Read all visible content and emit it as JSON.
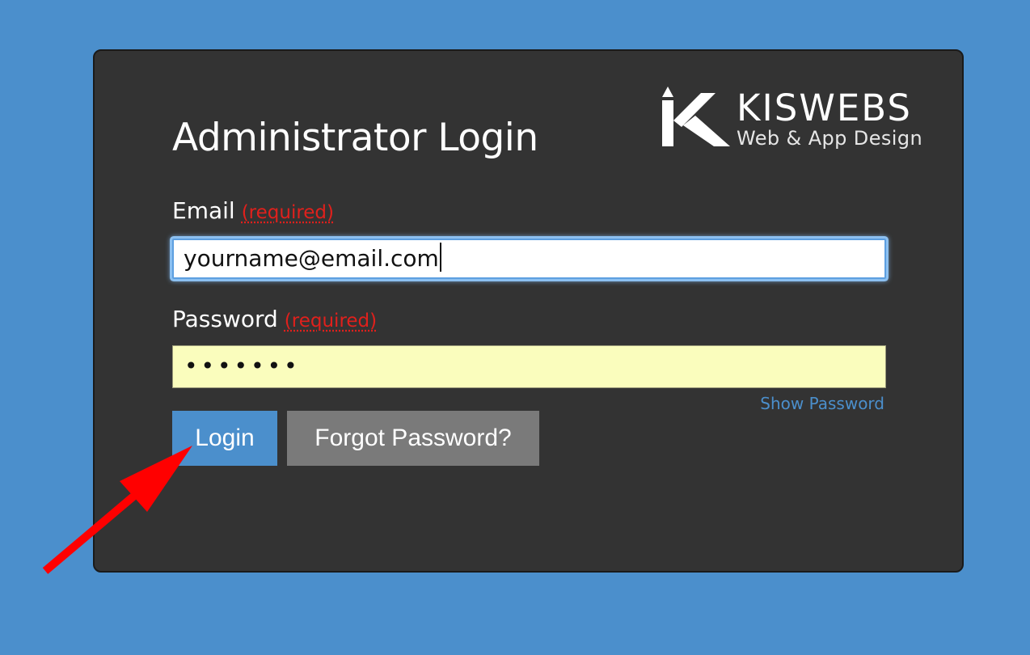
{
  "page": {
    "title": "Administrator Login"
  },
  "logo": {
    "name": "KISWEBS",
    "tagline": "Web & App Design",
    "icon": "kiswebs-k-house-logo"
  },
  "form": {
    "email": {
      "label": "Email",
      "required_text": "(required)",
      "value": "yourname@email.com"
    },
    "password": {
      "label": "Password",
      "required_text": "(required)",
      "value_masked": "•••••••"
    },
    "show_password_label": "Show Password",
    "login_label": "Login",
    "forgot_label": "Forgot Password?"
  },
  "colors": {
    "background": "#4b8fcc",
    "panel": "#333333",
    "login_button": "#4b8fcc",
    "forgot_button": "#7a7a7a",
    "required": "#e0201c",
    "password_field": "#fafdbd",
    "annotation_arrow": "#ff0000"
  },
  "annotation": {
    "icon": "red-arrow-icon"
  }
}
